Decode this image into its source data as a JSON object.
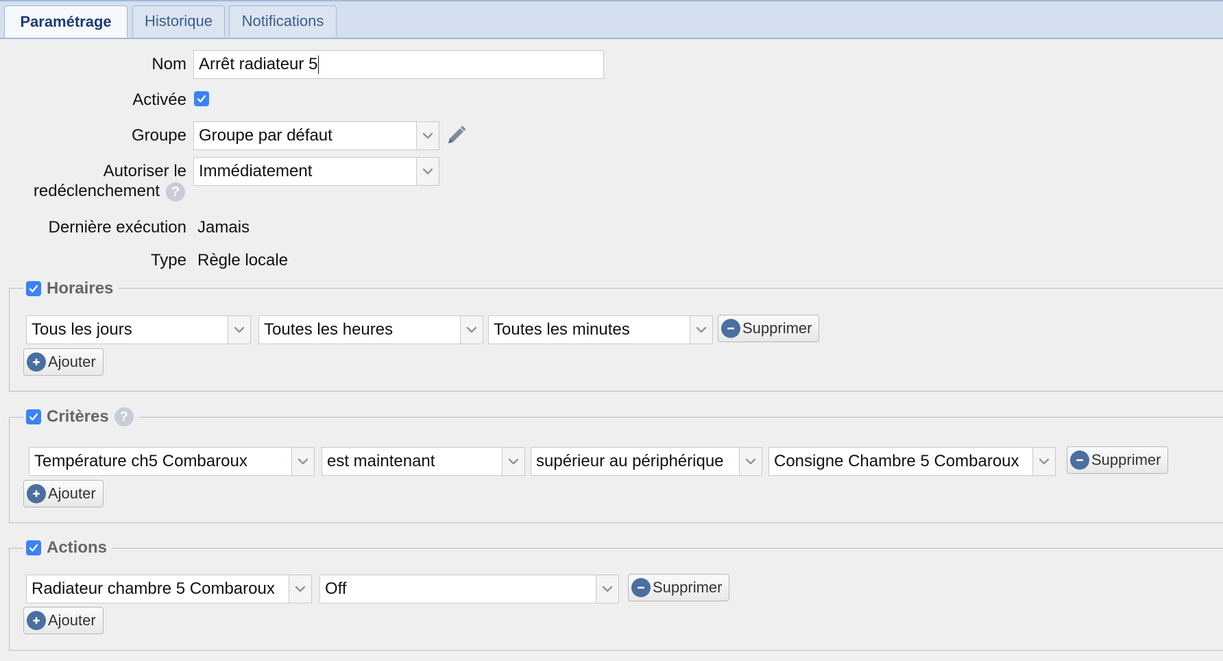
{
  "tabs": [
    {
      "label": "Paramétrage",
      "active": true
    },
    {
      "label": "Historique",
      "active": false
    },
    {
      "label": "Notifications",
      "active": false
    }
  ],
  "form": {
    "nom_label": "Nom",
    "nom_value": "Arrêt radiateur 5",
    "activee_label": "Activée",
    "activee_checked": true,
    "groupe_label": "Groupe",
    "groupe_value": "Groupe par défaut",
    "autoriser_label_line1": "Autoriser le",
    "autoriser_label_line2": "redéclenchement",
    "autoriser_value": "Immédiatement",
    "derniere_label": "Dernière exécution",
    "derniere_value": "Jamais",
    "type_label": "Type",
    "type_value": "Règle locale"
  },
  "horaires": {
    "title": "Horaires",
    "checked": true,
    "row": {
      "day": "Tous les jours",
      "hour": "Toutes les heures",
      "minute": "Toutes les minutes"
    },
    "remove_label": "Supprimer",
    "add_label": "Ajouter"
  },
  "criteres": {
    "title": "Critères",
    "checked": true,
    "row": {
      "device": "Température ch5 Combaroux",
      "timing": "est maintenant",
      "operator": "supérieur au périphérique",
      "target": "Consigne Chambre 5 Combaroux"
    },
    "remove_label": "Supprimer",
    "add_label": "Ajouter"
  },
  "actions": {
    "title": "Actions",
    "checked": true,
    "row": {
      "device": "Radiateur chambre 5 Combaroux",
      "command": "Off"
    },
    "remove_label": "Supprimer",
    "add_label": "Ajouter"
  },
  "colors": {
    "accent": "#3b82f6",
    "tab_bar": "#d4e0ef",
    "tab_text": "#3a5c8c",
    "button_icon": "#4a6fa0",
    "background": "#efefef"
  },
  "icons": {
    "checkbox": "checkmark-icon",
    "dropdown": "chevron-down-icon",
    "edit": "pencil-icon",
    "help": "help-icon",
    "remove": "minus-circle-icon",
    "add": "plus-circle-icon"
  }
}
